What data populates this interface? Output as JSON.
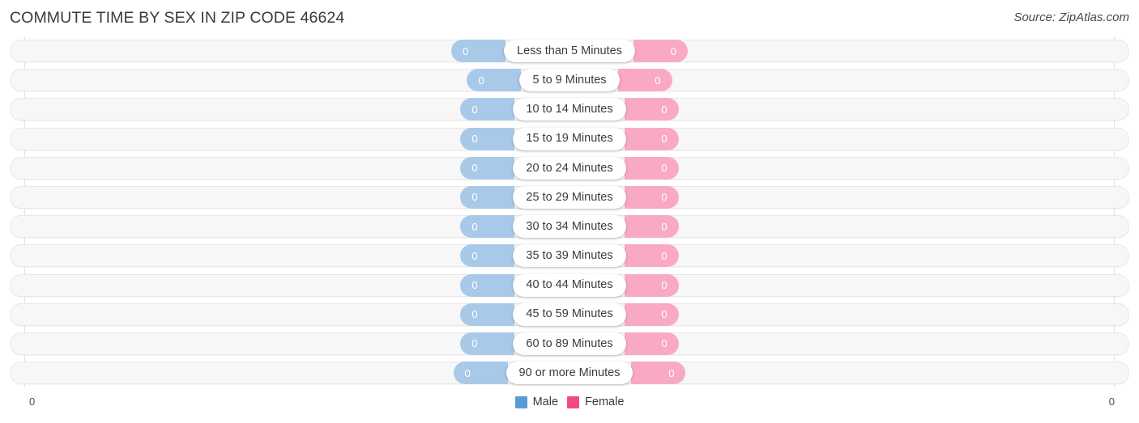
{
  "header": {
    "title": "COMMUTE TIME BY SEX IN ZIP CODE 46624",
    "source": "Source: ZipAtlas.com"
  },
  "axis": {
    "left_tick": "0",
    "right_tick": "0"
  },
  "legend": {
    "items": [
      {
        "label": "Male",
        "color": "#5b9bd5"
      },
      {
        "label": "Female",
        "color": "#f2497e"
      }
    ]
  },
  "colors": {
    "male_bar": "#a9c9e9",
    "female_bar": "#f9a9c5",
    "male_legend": "#5b9bd5",
    "female_legend": "#f2497e",
    "track": "#f7f7f7",
    "gridline": "#e2e2e2"
  },
  "chart_data": {
    "type": "bar",
    "title": "COMMUTE TIME BY SEX IN ZIP CODE 46624",
    "subtitle": "",
    "orientation": "horizontal-diverging",
    "xlabel": "",
    "ylabel": "",
    "xlim": [
      0,
      0
    ],
    "grid": true,
    "legend_position": "bottom-center",
    "categories": [
      "Less than 5 Minutes",
      "5 to 9 Minutes",
      "10 to 14 Minutes",
      "15 to 19 Minutes",
      "20 to 24 Minutes",
      "25 to 29 Minutes",
      "30 to 34 Minutes",
      "35 to 39 Minutes",
      "40 to 44 Minutes",
      "45 to 59 Minutes",
      "60 to 89 Minutes",
      "90 or more Minutes"
    ],
    "series": [
      {
        "name": "Male",
        "color": "#a9c9e9",
        "values": [
          0,
          0,
          0,
          0,
          0,
          0,
          0,
          0,
          0,
          0,
          0,
          0
        ],
        "labels": [
          "0",
          "0",
          "0",
          "0",
          "0",
          "0",
          "0",
          "0",
          "0",
          "0",
          "0",
          "0"
        ]
      },
      {
        "name": "Female",
        "color": "#f9a9c5",
        "values": [
          0,
          0,
          0,
          0,
          0,
          0,
          0,
          0,
          0,
          0,
          0,
          0
        ],
        "labels": [
          "0",
          "0",
          "0",
          "0",
          "0",
          "0",
          "0",
          "0",
          "0",
          "0",
          "0",
          "0"
        ]
      }
    ]
  },
  "rows": [
    {
      "label": "Less than 5 Minutes",
      "male": "0",
      "female": "0"
    },
    {
      "label": "5 to 9 Minutes",
      "male": "0",
      "female": "0"
    },
    {
      "label": "10 to 14 Minutes",
      "male": "0",
      "female": "0"
    },
    {
      "label": "15 to 19 Minutes",
      "male": "0",
      "female": "0"
    },
    {
      "label": "20 to 24 Minutes",
      "male": "0",
      "female": "0"
    },
    {
      "label": "25 to 29 Minutes",
      "male": "0",
      "female": "0"
    },
    {
      "label": "30 to 34 Minutes",
      "male": "0",
      "female": "0"
    },
    {
      "label": "35 to 39 Minutes",
      "male": "0",
      "female": "0"
    },
    {
      "label": "40 to 44 Minutes",
      "male": "0",
      "female": "0"
    },
    {
      "label": "45 to 59 Minutes",
      "male": "0",
      "female": "0"
    },
    {
      "label": "60 to 89 Minutes",
      "male": "0",
      "female": "0"
    },
    {
      "label": "90 or more Minutes",
      "male": "0",
      "female": "0"
    }
  ]
}
